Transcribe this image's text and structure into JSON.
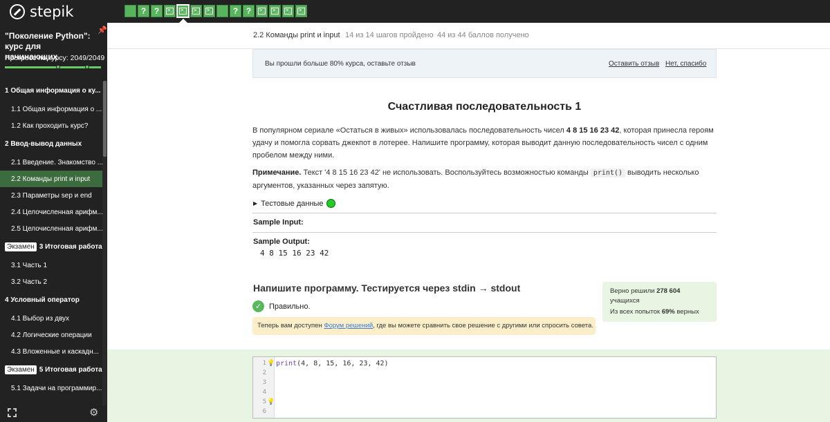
{
  "app": {
    "logo_text": "stepik"
  },
  "steps": [
    {
      "type": "text",
      "label": ""
    },
    {
      "type": "quiz",
      "label": "?"
    },
    {
      "type": "quiz",
      "label": "?"
    },
    {
      "type": "code",
      "label": ">_"
    },
    {
      "type": "code",
      "label": ">_",
      "active": true
    },
    {
      "type": "code",
      "label": ">_"
    },
    {
      "type": "code",
      "label": ">_"
    },
    {
      "type": "text",
      "label": ""
    },
    {
      "type": "quiz",
      "label": "?"
    },
    {
      "type": "quiz",
      "label": "?"
    },
    {
      "type": "code",
      "label": ">_"
    },
    {
      "type": "code",
      "label": ">_"
    },
    {
      "type": "code",
      "label": ">_"
    },
    {
      "type": "code",
      "label": ">_"
    }
  ],
  "sidebar": {
    "course_title": "\"Поколение Python\": курс для начинающих",
    "progress_label": "Прогресс по курсу:",
    "progress_value": "2049/2049",
    "progress_fraction": 1.0,
    "toc": [
      {
        "kind": "section",
        "label": "1  Общая информация о ку..."
      },
      {
        "kind": "lesson",
        "label": "1.1  Общая информация о ..."
      },
      {
        "kind": "lesson",
        "label": "1.2  Как проходить курс?"
      },
      {
        "kind": "section",
        "label": "2  Ввод-вывод данных"
      },
      {
        "kind": "lesson",
        "label": "2.1  Введение. Знакомство ..."
      },
      {
        "kind": "lesson",
        "label": "2.2  Команды print и input",
        "active": true
      },
      {
        "kind": "lesson",
        "label": "2.3  Параметры sep и end"
      },
      {
        "kind": "lesson",
        "label": "2.4  Целочисленная арифм..."
      },
      {
        "kind": "lesson",
        "label": "2.5  Целочисленная арифм..."
      },
      {
        "kind": "section",
        "badge": "Экзамен",
        "label": "3  Итоговая работа..."
      },
      {
        "kind": "lesson",
        "label": "3.1  Часть 1"
      },
      {
        "kind": "lesson",
        "label": "3.2  Часть 2"
      },
      {
        "kind": "section",
        "label": "4  Условный оператор"
      },
      {
        "kind": "lesson",
        "label": "4.1  Выбор из двух"
      },
      {
        "kind": "lesson",
        "label": "4.2  Логические операции"
      },
      {
        "kind": "lesson",
        "label": "4.3  Вложенные и каскадн..."
      },
      {
        "kind": "section",
        "badge": "Экзамен",
        "label": "5  Итоговая работа..."
      },
      {
        "kind": "lesson",
        "label": "5.1  Задачи на программир..."
      }
    ]
  },
  "header": {
    "breadcrumb": "2.2 Команды print и input",
    "steps_done": "14 из 14 шагов пройдено",
    "points": "44 из 44 баллов  получено"
  },
  "notice": {
    "message": "Вы прошли больше 80% курса, оставьте отзыв",
    "leave_review": "Оставить отзыв",
    "no_thanks": "Нет, спасибо"
  },
  "task": {
    "title": "Счастливая последовательность 1",
    "p1_a": "В популярном сериале «Остаться в живых» использовалась последовательность чисел ",
    "p1_b": "4 8 15 16 23 42",
    "p1_c": ", которая принесла героям удачу и помогла сорвать джекпот в лотерее. Напишите программу, которая выводит данную последовательность чисел с одним пробелом между ними.",
    "p2_a": "Примечание.",
    "p2_b": " Текст '4 8 15 16 23 42' не использовать. Воспользуйтесь возможностью команды ",
    "p2_code": "print()",
    "p2_c": " выводить несколько аргументов, указанных через запятую.",
    "tests_label": "Тестовые данные",
    "sample_input_label": "Sample Input:",
    "sample_output_label": "Sample Output:",
    "sample_output": "4 8 15 16 23 42"
  },
  "submission": {
    "heading": "Напишите программу. Тестируется через stdin → stdout",
    "result": "Правильно.",
    "forum_a": "Теперь вам доступен ",
    "forum_link": "Форум решений",
    "forum_b": ", где вы можете сравнить свое решение с другими или спросить совета.",
    "stats_a": "Верно решили ",
    "stats_count": "278 604",
    "stats_b": " учащихся",
    "stats_c": "Из всех попыток ",
    "stats_pct": "69%",
    "stats_d": " верных"
  },
  "editor": {
    "line_numbers": [
      "1",
      "2",
      "3",
      "4",
      "5",
      "6"
    ],
    "code_kw": "print",
    "code_rest": "(4, 8, 15, 16, 23, 42)"
  }
}
